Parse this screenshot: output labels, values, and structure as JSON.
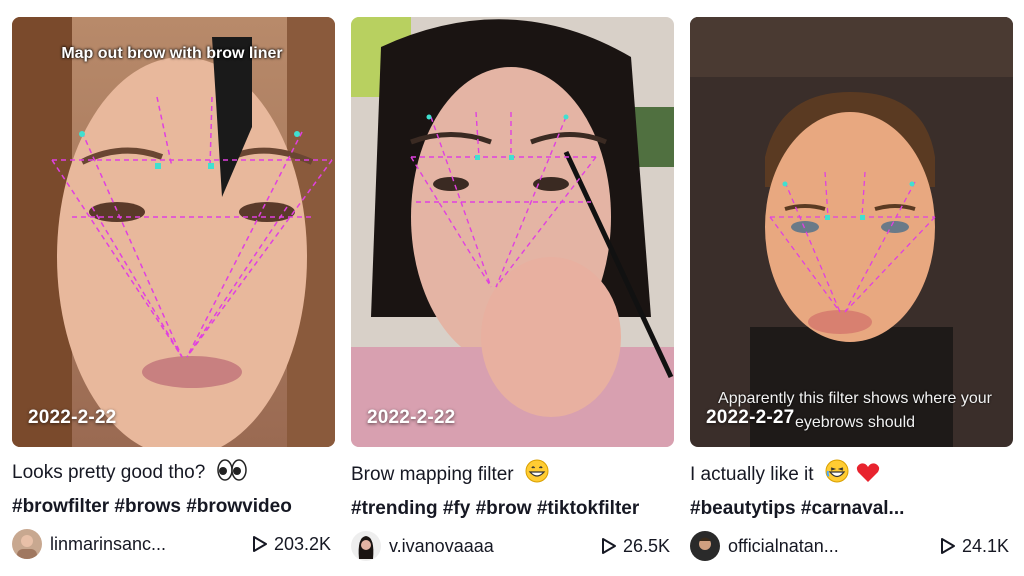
{
  "cards": [
    {
      "date": "2022-2-22",
      "overlay": "Map out brow with brow liner",
      "description": "Looks pretty good tho?",
      "emoji": "eyes-emoji",
      "tags": [
        "#browfilter",
        "#brows",
        "#browvideo"
      ],
      "author": "linmarinsanc...",
      "views": "203.2K"
    },
    {
      "date": "2022-2-22",
      "overlay": "",
      "description": "Brow mapping filter",
      "emoji": "grinning-emoji",
      "tags": [
        "#trending",
        "#fy",
        "#brow",
        "#tiktokfilter"
      ],
      "author": "v.ivanovaaaa",
      "views": "26.5K"
    },
    {
      "date": "2022-2-27",
      "overlay": "Apparently this filter shows where your eyebrows should",
      "description": "I actually like it",
      "emoji": "laughing-heart-emoji",
      "tags": [
        "#beautytips",
        "#carnaval..."
      ],
      "author": "officialnatan...",
      "views": "24.1K"
    }
  ],
  "colors": {
    "text": "#161823",
    "overlay_lines": "#e040e0",
    "overlay_points": "#40e0d0"
  },
  "icons": {
    "play": "play-icon"
  }
}
